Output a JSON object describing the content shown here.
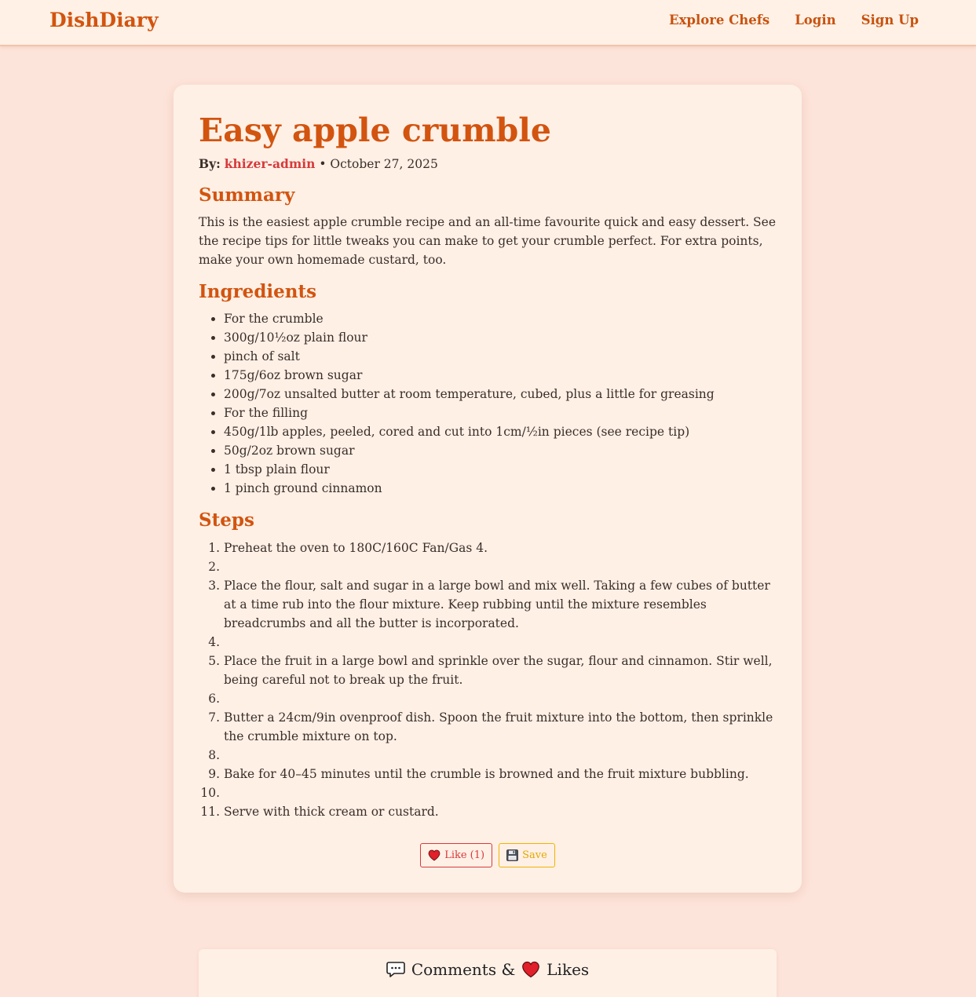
{
  "nav": {
    "brand": "DishDiary",
    "links": [
      "Explore Chefs",
      "Login",
      "Sign Up"
    ]
  },
  "recipe": {
    "title": "Easy apple crumble",
    "by_label": "By:",
    "author": "khizer-admin",
    "date": "• October 27, 2025",
    "summary_heading": "Summary",
    "summary": "This is the easiest apple crumble recipe and an all-time favourite quick and easy dessert. See the recipe tips for little tweaks you can make to get your crumble perfect. For extra points, make your own homemade custard, too.",
    "ingredients_heading": "Ingredients",
    "ingredients": [
      "For the crumble",
      "300g/10½oz plain flour",
      "pinch of salt",
      "175g/6oz brown sugar",
      "200g/7oz unsalted butter at room temperature, cubed, plus a little for greasing",
      "For the filling",
      "450g/1lb apples, peeled, cored and cut into 1cm/½in pieces (see recipe tip)",
      "50g/2oz brown sugar",
      "1 tbsp plain flour",
      "1 pinch ground cinnamon"
    ],
    "steps_heading": "Steps",
    "steps": [
      "Preheat the oven to 180C/160C Fan/Gas 4.",
      "",
      "Place the flour, salt and sugar in a large bowl and mix well. Taking a few cubes of butter at a time rub into the flour mixture. Keep rubbing until the mixture resembles breadcrumbs and all the butter is incorporated.",
      "",
      "Place the fruit in a large bowl and sprinkle over the sugar, flour and cinnamon. Stir well, being careful not to break up the fruit.",
      "",
      "Butter a 24cm/9in ovenproof dish. Spoon the fruit mixture into the bottom, then sprinkle the crumble mixture on top.",
      "",
      "Bake for 40–45 minutes until the crumble is browned and the fruit mixture bubbling.",
      "",
      "Serve with thick cream or custard."
    ]
  },
  "actions": {
    "like_label": "Like (1)",
    "like_icon": "heart-icon",
    "save_label": "Save",
    "save_icon": "floppy-disk-icon"
  },
  "comments": {
    "heading_part1": "Comments &",
    "heading_part2": "Likes",
    "icons": [
      "speech-bubble-icon",
      "heart-icon"
    ]
  },
  "colors": {
    "brand": "#d2540f",
    "author": "#d63a3a",
    "like": "#d63a3a",
    "save": "#f0b400",
    "background": "#fde4da",
    "card": "#fff0e6"
  }
}
